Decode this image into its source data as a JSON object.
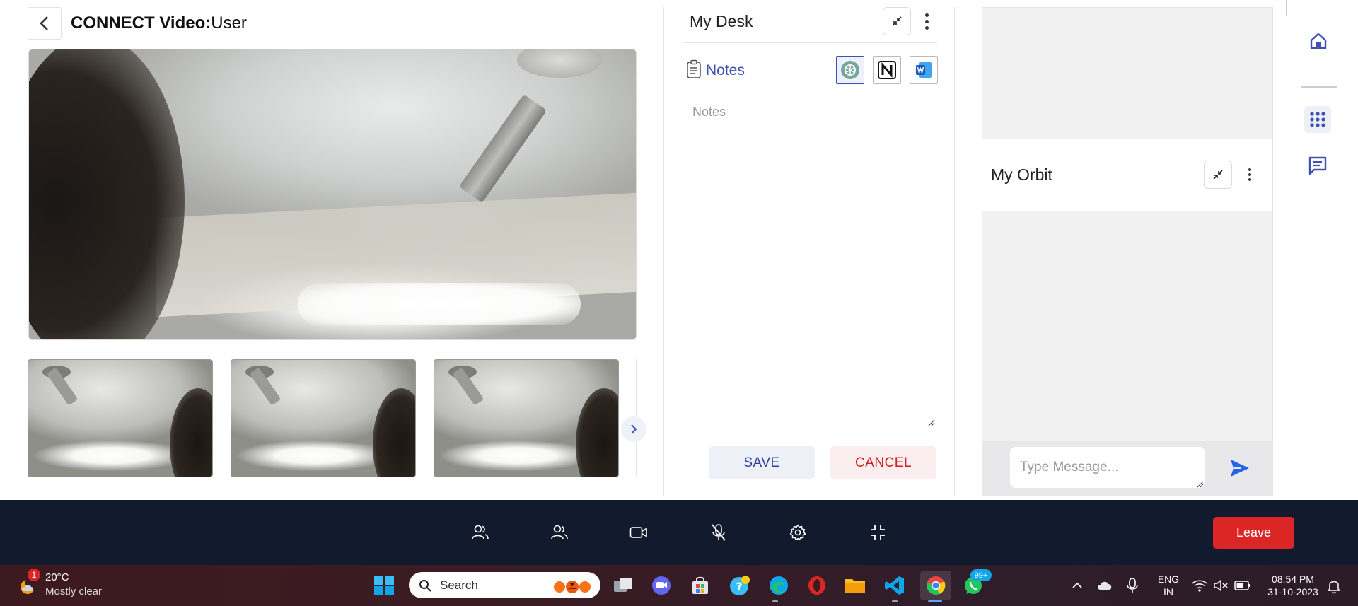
{
  "header": {
    "title_bold": "CONNECT Video:",
    "title_rest": "User"
  },
  "desk": {
    "title": "My Desk",
    "notes_tab": "Notes",
    "notes_placeholder": "Notes",
    "save_label": "SAVE",
    "cancel_label": "CANCEL",
    "apps": [
      "chatgpt-icon",
      "notion-icon",
      "word-icon"
    ]
  },
  "orbit": {
    "title": "My Orbit",
    "message_placeholder": "Type Message..."
  },
  "controls": {
    "icons": [
      "participants-icon",
      "group-icon",
      "camera-icon",
      "mic-muted-icon",
      "settings-icon",
      "exit-fullscreen-icon"
    ],
    "leave_label": "Leave"
  },
  "rail": {
    "icons": [
      "home-icon",
      "apps-grid-icon",
      "chat-icon"
    ]
  },
  "taskbar": {
    "weather_temp": "20°C",
    "weather_desc": "Mostly clear",
    "weather_badge": "1",
    "search_label": "Search",
    "whatsapp_badge": "99+",
    "lang_top": "ENG",
    "lang_bottom": "IN",
    "time": "08:54 PM",
    "date": "31-10-2023"
  },
  "colors": {
    "accent": "#3f51b5",
    "leave": "#dc2626",
    "controlbar": "#111b2d",
    "cancel": "#cc1f1f"
  }
}
